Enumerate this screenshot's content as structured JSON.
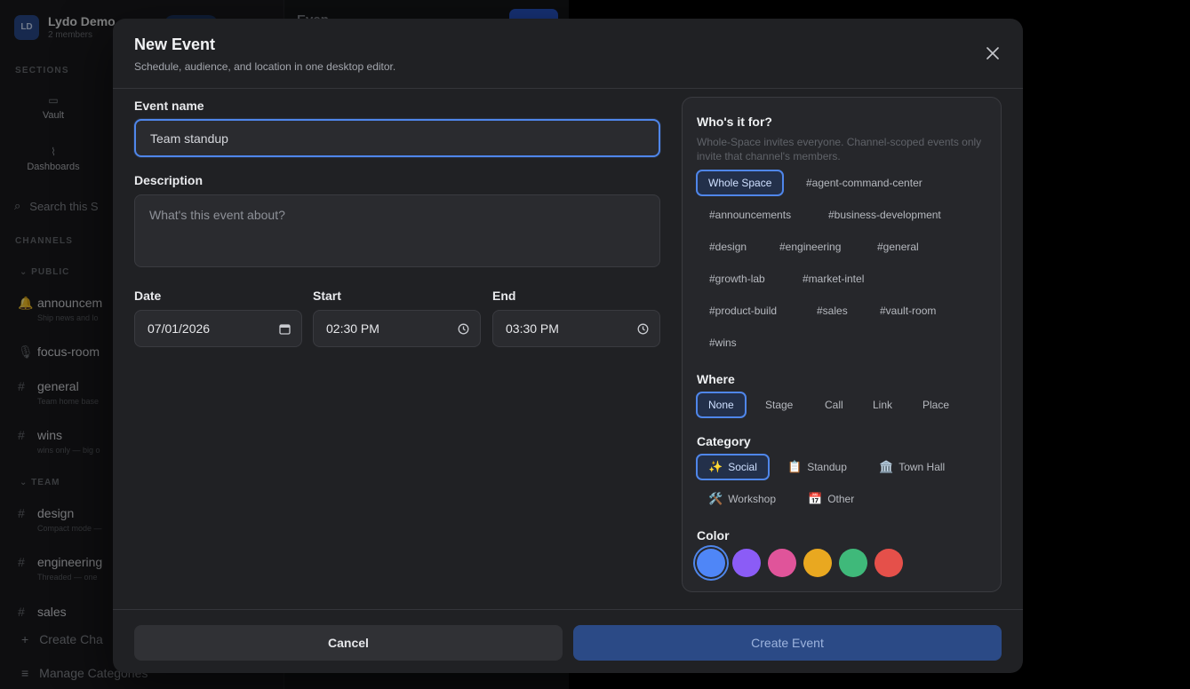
{
  "background": {
    "workspace": {
      "avatar": "LD",
      "name": "Lydo Demo",
      "members": "2 members"
    },
    "sections_label": "SECTIONS",
    "nav": [
      {
        "label": "Vault",
        "icon": "vault-icon"
      },
      {
        "label": "Dashboards",
        "icon": "chart-icon"
      }
    ],
    "search_placeholder": "Search this S",
    "channels_label": "CHANNELS",
    "groups": {
      "public": "PUBLIC",
      "team": "TEAM"
    },
    "channels": [
      {
        "name": "announcem",
        "desc": "Ship news and lo",
        "icon": "bell-icon"
      },
      {
        "name": "focus-room",
        "desc": "",
        "icon": "mic-icon"
      },
      {
        "name": "general",
        "desc": "Team home base",
        "icon": "hash-icon"
      },
      {
        "name": "wins",
        "desc": "wins only — big o",
        "icon": "hash-icon"
      },
      {
        "name": "design",
        "desc": "Compact mode —",
        "icon": "hash-icon"
      },
      {
        "name": "engineering",
        "desc": "Threaded — one",
        "icon": "hash-icon"
      },
      {
        "name": "sales",
        "desc": "",
        "icon": "hash-icon"
      }
    ],
    "footer": {
      "create": "Create Cha",
      "manage": "Manage Categories"
    },
    "main_title": "Even"
  },
  "modal": {
    "title": "New Event",
    "subtitle": "Schedule, audience, and location in one desktop editor.",
    "event_name": {
      "label": "Event name",
      "value": "Team standup"
    },
    "description": {
      "label": "Description",
      "placeholder": "What's this event about?"
    },
    "date": {
      "label": "Date",
      "value": "07/01/2026"
    },
    "start": {
      "label": "Start",
      "value": "02:30 PM"
    },
    "end": {
      "label": "End",
      "value": "03:30 PM"
    },
    "audience": {
      "label": "Who's it for?",
      "help": "Whole-Space invites everyone. Channel-scoped events only invite that channel's members.",
      "options": [
        "Whole Space",
        "#agent-command-center",
        "#announcements",
        "#business-development",
        "#design",
        "#engineering",
        "#general",
        "#growth-lab",
        "#market-intel",
        "#product-build",
        "#sales",
        "#vault-room",
        "#wins"
      ],
      "selected": "Whole Space"
    },
    "where": {
      "label": "Where",
      "options": [
        "None",
        "Stage",
        "Call",
        "Link",
        "Place"
      ],
      "selected": "None"
    },
    "category": {
      "label": "Category",
      "options": [
        {
          "emoji": "✨",
          "label": "Social"
        },
        {
          "emoji": "📋",
          "label": "Standup"
        },
        {
          "emoji": "🏛️",
          "label": "Town Hall"
        },
        {
          "emoji": "🛠️",
          "label": "Workshop"
        },
        {
          "emoji": "📅",
          "label": "Other"
        }
      ],
      "selected": "Social"
    },
    "color": {
      "label": "Color",
      "options": [
        "#4f86f7",
        "#8b5cf6",
        "#e0549a",
        "#e9a820",
        "#3fb97a",
        "#e5504a"
      ],
      "selected": "#4f86f7"
    },
    "cancel_label": "Cancel",
    "create_label": "Create Event"
  }
}
